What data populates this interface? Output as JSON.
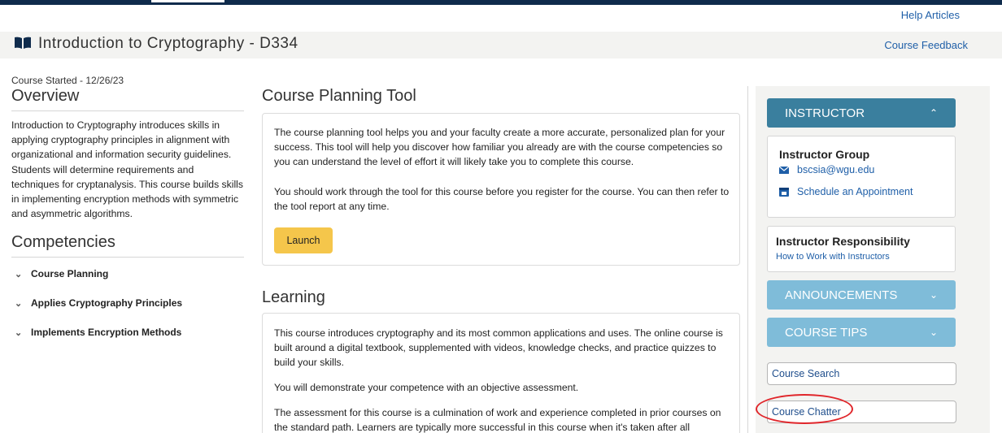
{
  "header": {
    "help_articles": "Help Articles",
    "course_title": "Introduction to Cryptography - D334",
    "course_feedback": "Course Feedback"
  },
  "overview": {
    "course_started": "Course Started - 12/26/23",
    "heading": "Overview",
    "description": "Introduction to Cryptography introduces skills in applying cryptography principles in alignment with organizational and information security guidelines. Students will determine requirements and techniques for cryptanalysis. This course builds skills in implementing encryption methods with symmetric and asymmetric algorithms."
  },
  "competencies": {
    "heading": "Competencies",
    "items": [
      {
        "label": "Course Planning"
      },
      {
        "label": "Applies Cryptography Principles"
      },
      {
        "label": "Implements Encryption Methods"
      }
    ]
  },
  "planning_tool": {
    "heading": "Course Planning Tool",
    "para1": "The course planning tool helps you and your faculty create a more accurate, personalized plan for your success. This tool will help you discover how familiar you already are with the course competencies so you can understand the level of effort it will likely take you to complete this course.",
    "para2": "You should work through the tool for this course before you register for the course. You can then refer to the tool report at any time.",
    "launch_label": "Launch"
  },
  "learning": {
    "heading": "Learning",
    "para1": "This course introduces cryptography and its most common applications and uses. The online course is built around a digital textbook, supplemented with videos, knowledge checks, and practice quizzes to build your skills.",
    "para2": "You will demonstrate your competence with an objective assessment.",
    "para3": "The assessment for this course is a culmination of work and experience completed in prior courses on the standard path. Learners are typically more successful in this course when it's taken after all"
  },
  "sidebar": {
    "instructor_header": "INSTRUCTOR",
    "instructor_group_title": "Instructor Group",
    "email": "bscsia@wgu.edu",
    "schedule_label": "Schedule an Appointment",
    "responsibility_title": "Instructor Responsibility",
    "responsibility_link": "How to Work with Instructors",
    "announcements_header": "ANNOUNCEMENTS",
    "course_tips_header": "COURSE TIPS",
    "course_search": "Course Search",
    "course_chatter": "Course Chatter"
  },
  "colors": {
    "nav_dark": "#0f2b4c",
    "link_blue": "#1f5fa8",
    "accordion_active": "#3a7f9e",
    "accordion_inactive": "#7fbcd9",
    "launch_yellow": "#f5c64b",
    "annotation_red": "#e0262b"
  },
  "icons": {
    "title_icon": "book-icon",
    "email_icon": "envelope-icon",
    "schedule_icon": "calendar-icon",
    "accordion_collapse": "chevron-up-icon",
    "accordion_expand": "chevron-down-icon"
  }
}
